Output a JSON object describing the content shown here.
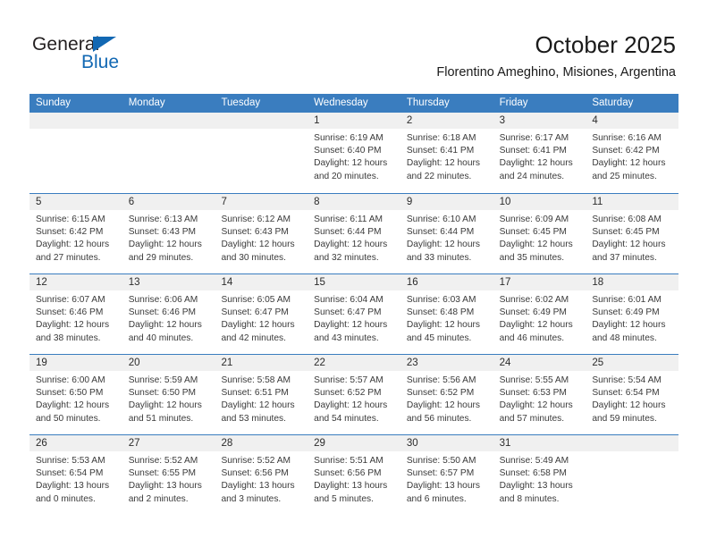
{
  "brand": {
    "name_part1": "General",
    "name_part2": "Blue",
    "logo_icon": "triangle-icon",
    "accent_color": "#1268b3"
  },
  "header": {
    "title": "October 2025",
    "subtitle": "Florentino Ameghino, Misiones, Argentina"
  },
  "calendar": {
    "header_bg": "#3a7dbf",
    "day_strip_bg": "#f0f0f0",
    "weekdays": [
      "Sunday",
      "Monday",
      "Tuesday",
      "Wednesday",
      "Thursday",
      "Friday",
      "Saturday"
    ],
    "weeks": [
      [
        {
          "day": "",
          "empty": true
        },
        {
          "day": "",
          "empty": true
        },
        {
          "day": "",
          "empty": true
        },
        {
          "day": "1",
          "sunrise": "Sunrise: 6:19 AM",
          "sunset": "Sunset: 6:40 PM",
          "daylight": "Daylight: 12 hours and 20 minutes."
        },
        {
          "day": "2",
          "sunrise": "Sunrise: 6:18 AM",
          "sunset": "Sunset: 6:41 PM",
          "daylight": "Daylight: 12 hours and 22 minutes."
        },
        {
          "day": "3",
          "sunrise": "Sunrise: 6:17 AM",
          "sunset": "Sunset: 6:41 PM",
          "daylight": "Daylight: 12 hours and 24 minutes."
        },
        {
          "day": "4",
          "sunrise": "Sunrise: 6:16 AM",
          "sunset": "Sunset: 6:42 PM",
          "daylight": "Daylight: 12 hours and 25 minutes."
        }
      ],
      [
        {
          "day": "5",
          "sunrise": "Sunrise: 6:15 AM",
          "sunset": "Sunset: 6:42 PM",
          "daylight": "Daylight: 12 hours and 27 minutes."
        },
        {
          "day": "6",
          "sunrise": "Sunrise: 6:13 AM",
          "sunset": "Sunset: 6:43 PM",
          "daylight": "Daylight: 12 hours and 29 minutes."
        },
        {
          "day": "7",
          "sunrise": "Sunrise: 6:12 AM",
          "sunset": "Sunset: 6:43 PM",
          "daylight": "Daylight: 12 hours and 30 minutes."
        },
        {
          "day": "8",
          "sunrise": "Sunrise: 6:11 AM",
          "sunset": "Sunset: 6:44 PM",
          "daylight": "Daylight: 12 hours and 32 minutes."
        },
        {
          "day": "9",
          "sunrise": "Sunrise: 6:10 AM",
          "sunset": "Sunset: 6:44 PM",
          "daylight": "Daylight: 12 hours and 33 minutes."
        },
        {
          "day": "10",
          "sunrise": "Sunrise: 6:09 AM",
          "sunset": "Sunset: 6:45 PM",
          "daylight": "Daylight: 12 hours and 35 minutes."
        },
        {
          "day": "11",
          "sunrise": "Sunrise: 6:08 AM",
          "sunset": "Sunset: 6:45 PM",
          "daylight": "Daylight: 12 hours and 37 minutes."
        }
      ],
      [
        {
          "day": "12",
          "sunrise": "Sunrise: 6:07 AM",
          "sunset": "Sunset: 6:46 PM",
          "daylight": "Daylight: 12 hours and 38 minutes."
        },
        {
          "day": "13",
          "sunrise": "Sunrise: 6:06 AM",
          "sunset": "Sunset: 6:46 PM",
          "daylight": "Daylight: 12 hours and 40 minutes."
        },
        {
          "day": "14",
          "sunrise": "Sunrise: 6:05 AM",
          "sunset": "Sunset: 6:47 PM",
          "daylight": "Daylight: 12 hours and 42 minutes."
        },
        {
          "day": "15",
          "sunrise": "Sunrise: 6:04 AM",
          "sunset": "Sunset: 6:47 PM",
          "daylight": "Daylight: 12 hours and 43 minutes."
        },
        {
          "day": "16",
          "sunrise": "Sunrise: 6:03 AM",
          "sunset": "Sunset: 6:48 PM",
          "daylight": "Daylight: 12 hours and 45 minutes."
        },
        {
          "day": "17",
          "sunrise": "Sunrise: 6:02 AM",
          "sunset": "Sunset: 6:49 PM",
          "daylight": "Daylight: 12 hours and 46 minutes."
        },
        {
          "day": "18",
          "sunrise": "Sunrise: 6:01 AM",
          "sunset": "Sunset: 6:49 PM",
          "daylight": "Daylight: 12 hours and 48 minutes."
        }
      ],
      [
        {
          "day": "19",
          "sunrise": "Sunrise: 6:00 AM",
          "sunset": "Sunset: 6:50 PM",
          "daylight": "Daylight: 12 hours and 50 minutes."
        },
        {
          "day": "20",
          "sunrise": "Sunrise: 5:59 AM",
          "sunset": "Sunset: 6:50 PM",
          "daylight": "Daylight: 12 hours and 51 minutes."
        },
        {
          "day": "21",
          "sunrise": "Sunrise: 5:58 AM",
          "sunset": "Sunset: 6:51 PM",
          "daylight": "Daylight: 12 hours and 53 minutes."
        },
        {
          "day": "22",
          "sunrise": "Sunrise: 5:57 AM",
          "sunset": "Sunset: 6:52 PM",
          "daylight": "Daylight: 12 hours and 54 minutes."
        },
        {
          "day": "23",
          "sunrise": "Sunrise: 5:56 AM",
          "sunset": "Sunset: 6:52 PM",
          "daylight": "Daylight: 12 hours and 56 minutes."
        },
        {
          "day": "24",
          "sunrise": "Sunrise: 5:55 AM",
          "sunset": "Sunset: 6:53 PM",
          "daylight": "Daylight: 12 hours and 57 minutes."
        },
        {
          "day": "25",
          "sunrise": "Sunrise: 5:54 AM",
          "sunset": "Sunset: 6:54 PM",
          "daylight": "Daylight: 12 hours and 59 minutes."
        }
      ],
      [
        {
          "day": "26",
          "sunrise": "Sunrise: 5:53 AM",
          "sunset": "Sunset: 6:54 PM",
          "daylight": "Daylight: 13 hours and 0 minutes."
        },
        {
          "day": "27",
          "sunrise": "Sunrise: 5:52 AM",
          "sunset": "Sunset: 6:55 PM",
          "daylight": "Daylight: 13 hours and 2 minutes."
        },
        {
          "day": "28",
          "sunrise": "Sunrise: 5:52 AM",
          "sunset": "Sunset: 6:56 PM",
          "daylight": "Daylight: 13 hours and 3 minutes."
        },
        {
          "day": "29",
          "sunrise": "Sunrise: 5:51 AM",
          "sunset": "Sunset: 6:56 PM",
          "daylight": "Daylight: 13 hours and 5 minutes."
        },
        {
          "day": "30",
          "sunrise": "Sunrise: 5:50 AM",
          "sunset": "Sunset: 6:57 PM",
          "daylight": "Daylight: 13 hours and 6 minutes."
        },
        {
          "day": "31",
          "sunrise": "Sunrise: 5:49 AM",
          "sunset": "Sunset: 6:58 PM",
          "daylight": "Daylight: 13 hours and 8 minutes."
        },
        {
          "day": "",
          "empty": true
        }
      ]
    ]
  }
}
